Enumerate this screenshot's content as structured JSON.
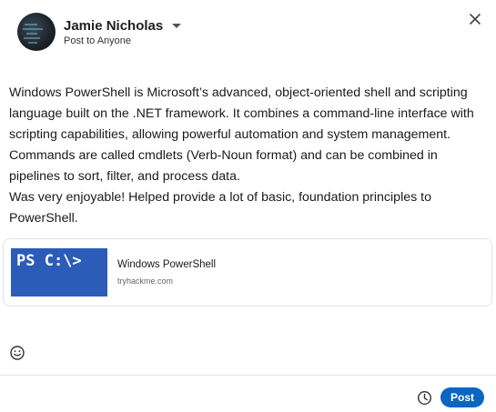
{
  "author": {
    "name": "Jamie Nicholas",
    "audience": "Post to Anyone"
  },
  "post": {
    "text": "Windows PowerShell is Microsoft’s advanced, object-oriented shell and scripting language built on the .NET framework. It combines a command-line interface with scripting capabilities, allowing powerful automation and system management. Commands are called cmdlets (Verb-Noun format) and can be combined in pipelines to sort, filter, and process data.\nWas very enjoyable! Helped provide a lot of basic, foundation principles to PowerShell."
  },
  "link_preview": {
    "thumbnail_text": "PS C:\\>",
    "title": "Windows PowerShell",
    "domain": "tryhackme.com",
    "thumbnail_color": "#2b5cb8"
  },
  "footer": {
    "post_label": "Post",
    "post_color": "#0a66c2"
  },
  "icons": {
    "close": "close-icon",
    "caret": "chevron-down-icon",
    "emoji": "emoji-icon",
    "schedule": "clock-icon"
  }
}
